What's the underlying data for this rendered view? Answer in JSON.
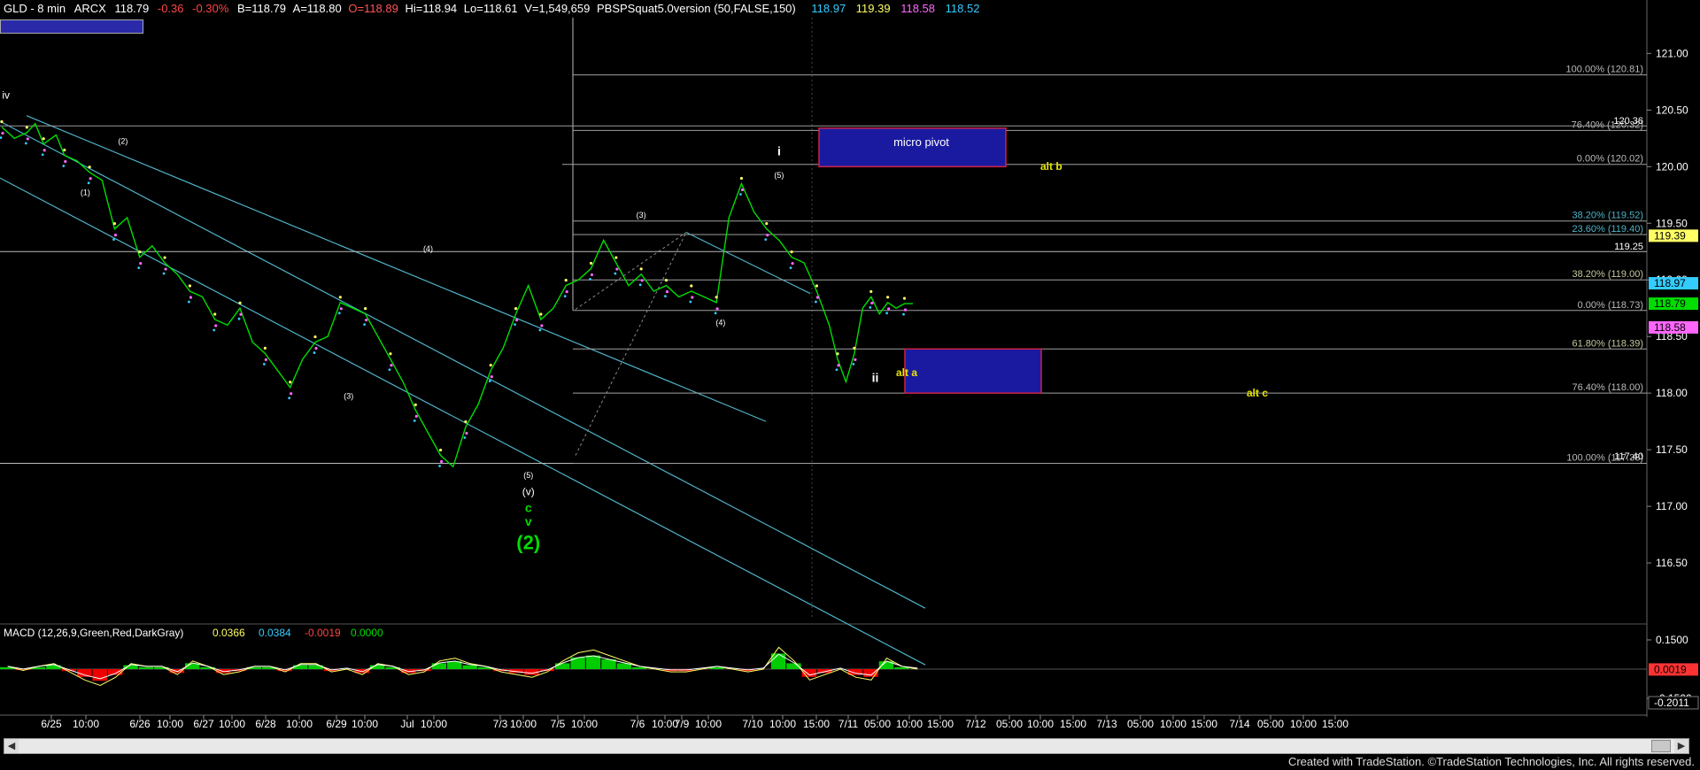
{
  "header": {
    "symbol": "GLD - 8 min",
    "exchange": "ARCX",
    "last": "118.79",
    "change": "-0.36",
    "change_pct": "-0.30%",
    "bid": "B=118.79",
    "ask": "A=118.80",
    "open": "O=118.89",
    "high": "Hi=118.94",
    "low": "Lo=118.61",
    "volume": "V=1,549,659",
    "indicator": "PBSPSquat5.0version (50,FALSE,150)",
    "ind_vals": [
      "118.97",
      "119.39",
      "118.58",
      "118.52"
    ]
  },
  "colors": {
    "background": "#000000",
    "price": "#00dd00",
    "dot_yellow": "#ffff66",
    "dot_pink": "#ff66ff",
    "dot_cyan": "#33ccff",
    "channel": "#4fb3c8",
    "fib": "#a0a0a0",
    "wave_label": "#ffffff",
    "wave_green": "#00dd00",
    "alt_label": "#e6e600",
    "box_fill": "#1a1aa0",
    "box_border": "#cc2244",
    "macd_up": "#00cc00",
    "macd_down": "#ee0000"
  },
  "chart_data": {
    "type": "line",
    "title": "GLD - 8 min",
    "x_tick_labels": [
      "6/25",
      "10:00",
      "6/26",
      "10:00",
      "6/27",
      "10:00",
      "6/28",
      "10:00",
      "6/29",
      "10:00",
      "Jul",
      "10:00",
      "7/3",
      "10:00",
      "7/5",
      "10:00",
      "7/6",
      "10:00",
      "7/9",
      "10:00",
      "7/10",
      "10:00",
      "15:00",
      "7/11",
      "05:00",
      "10:00",
      "15:00",
      "7/12",
      "05:00",
      "10:00",
      "15:00",
      "7/13",
      "05:00",
      "10:00",
      "15:00",
      "7/14",
      "05:00",
      "10:00",
      "15:00"
    ],
    "y_tick_labels": [
      "121.00",
      "120.50",
      "120.00",
      "119.50",
      "119.00",
      "118.50",
      "118.00",
      "117.50",
      "117.00",
      "116.50"
    ],
    "ylim": [
      116.0,
      121.3
    ],
    "price_path": {
      "x_index": [
        0,
        3,
        6,
        8,
        10,
        13,
        15,
        18,
        21,
        24,
        27,
        30,
        33,
        36,
        39,
        42,
        45,
        48,
        51,
        54,
        57,
        60,
        63,
        66,
        69,
        72,
        75,
        78,
        81,
        84,
        87,
        90,
        93,
        96,
        99,
        102,
        105,
        108,
        111,
        114,
        117,
        120,
        123,
        126,
        129,
        132,
        135,
        138,
        141,
        144,
        147,
        150,
        153,
        156,
        159,
        162,
        165,
        168,
        171,
        174,
        177,
        180,
        183,
        186,
        189,
        192,
        195,
        198,
        200,
        202,
        204,
        206,
        208,
        210,
        212,
        214,
        216,
        218
      ],
      "close": [
        120.35,
        120.25,
        120.3,
        120.38,
        120.2,
        120.28,
        120.1,
        120.05,
        119.95,
        119.88,
        119.45,
        119.55,
        119.2,
        119.3,
        119.15,
        119.05,
        118.9,
        118.85,
        118.65,
        118.6,
        118.75,
        118.45,
        118.35,
        118.2,
        118.05,
        118.3,
        118.45,
        118.5,
        118.8,
        118.75,
        118.7,
        118.5,
        118.3,
        118.1,
        117.85,
        117.65,
        117.45,
        117.35,
        117.7,
        117.9,
        118.2,
        118.4,
        118.7,
        118.95,
        118.65,
        118.75,
        118.95,
        119.0,
        119.1,
        119.35,
        119.15,
        118.95,
        119.05,
        118.9,
        118.95,
        118.85,
        118.9,
        118.85,
        118.8,
        119.55,
        119.85,
        119.6,
        119.45,
        119.35,
        119.2,
        119.15,
        118.9,
        118.6,
        118.3,
        118.1,
        118.35,
        118.75,
        118.85,
        118.7,
        118.8,
        118.75,
        118.79,
        118.79
      ]
    },
    "fib_levels": [
      {
        "label": "100.00% (120.81)",
        "value": 120.81
      },
      {
        "label": "76.40% (120.32)",
        "value": 120.32
      },
      {
        "label": "0.00% (120.02)",
        "value": 120.02
      },
      {
        "label": "38.20% (119.52)",
        "value": 119.52
      },
      {
        "label": "23.60% (119.40)",
        "value": 119.4
      },
      {
        "label": "38.20% (119.00)",
        "value": 119.0
      },
      {
        "label": "0.00% (118.73)",
        "value": 118.73
      },
      {
        "label": "61.80% (118.39)",
        "value": 118.39
      },
      {
        "label": "76.40% (118.00)",
        "value": 118.0
      },
      {
        "label": "100.00% (117.38)",
        "value": 117.38
      }
    ],
    "price_tags": [
      {
        "value": 119.39,
        "label": "119.39",
        "color": "#ffff66"
      },
      {
        "value": 118.97,
        "label": "118.97",
        "color": "#33ccff"
      },
      {
        "value": 118.79,
        "label": "118.79",
        "color": "#00dd00"
      },
      {
        "value": 118.58,
        "label": "118.58",
        "color": "#ff66ff"
      }
    ],
    "level_text": [
      {
        "value": 119.25,
        "label": "119.25"
      },
      {
        "value": 120.36,
        "label": "120.36"
      },
      {
        "value": 117.4,
        "label": "117.40"
      }
    ],
    "wave_labels": [
      {
        "text": "iv",
        "x_index": 1,
        "value": 120.6,
        "color": "#ffffff",
        "size": 12
      },
      {
        "text": "(1)",
        "x_index": 20,
        "value": 119.75,
        "color": "#ffffff",
        "size": 9
      },
      {
        "text": "(2)",
        "x_index": 29,
        "value": 120.2,
        "color": "#ffffff",
        "size": 9
      },
      {
        "text": "(3)",
        "x_index": 83,
        "value": 117.95,
        "color": "#ffffff",
        "size": 9
      },
      {
        "text": "(4)",
        "x_index": 102,
        "value": 119.25,
        "color": "#ffffff",
        "size": 9
      },
      {
        "text": "(5)",
        "x_index": 126,
        "value": 117.25,
        "color": "#ffffff",
        "size": 9
      },
      {
        "text": "(v)",
        "x_index": 126,
        "value": 117.1,
        "color": "#ffffff",
        "size": 12
      },
      {
        "text": "c",
        "x_index": 126,
        "value": 116.95,
        "color": "#00dd00",
        "size": 14
      },
      {
        "text": "v",
        "x_index": 126,
        "value": 116.83,
        "color": "#00dd00",
        "size": 14
      },
      {
        "text": "(2)",
        "x_index": 126,
        "value": 116.62,
        "color": "#00dd00",
        "size": 22
      },
      {
        "text": "(3)",
        "x_index": 153,
        "value": 119.55,
        "color": "#ffffff",
        "size": 9
      },
      {
        "text": "(4)",
        "x_index": 172,
        "value": 118.6,
        "color": "#ffffff",
        "size": 9
      },
      {
        "text": "(5)",
        "x_index": 186,
        "value": 119.9,
        "color": "#ffffff",
        "size": 9
      },
      {
        "text": "i",
        "x_index": 186,
        "value": 120.1,
        "color": "#ffffff",
        "size": 14
      },
      {
        "text": "ii",
        "x_index": 209,
        "value": 118.1,
        "color": "#ffffff",
        "size": 14
      }
    ],
    "alt_labels": [
      {
        "text": "alt b",
        "x": 1175,
        "y": 192
      },
      {
        "text": "alt a",
        "x": 1012,
        "y": 425
      },
      {
        "text": "alt c",
        "x": 1408,
        "y": 448
      }
    ],
    "boxes": [
      {
        "label": "micro pivot",
        "hi": 120.34,
        "lo": 120.0,
        "x1": 925,
        "x2": 1136
      },
      {
        "label": "",
        "hi": 118.39,
        "lo": 118.0,
        "x1": 1022,
        "x2": 1176
      }
    ],
    "macd": {
      "title": "MACD (12,26,9,Green,Red,DarkGray)",
      "values": [
        "0.0366",
        "0.0384",
        "-0.0019",
        "0.0000"
      ],
      "value_colors": [
        "#ffff66",
        "#33ccff",
        "#ff4444",
        "#00dd00"
      ],
      "y_tick_labels": [
        "0.1500",
        "-0.1500"
      ],
      "ylim": [
        -0.2,
        0.2
      ],
      "tags": [
        {
          "label": "0.0019",
          "value": -0.0019
        },
        {
          "label": "-0.2011",
          "value": -0.2011
        }
      ],
      "hist": [
        0.01,
        -0.005,
        0.01,
        0.02,
        -0.01,
        -0.04,
        -0.06,
        -0.03,
        0.02,
        0.01,
        0.01,
        -0.02,
        0.03,
        0.01,
        -0.02,
        -0.01,
        0.01,
        0.01,
        -0.01,
        0.02,
        0.02,
        -0.01,
        0.0,
        -0.02,
        0.02,
        0.01,
        -0.02,
        -0.01,
        0.03,
        0.04,
        0.02,
        0.01,
        -0.01,
        -0.02,
        -0.03,
        -0.01,
        0.03,
        0.06,
        0.07,
        0.05,
        0.03,
        0.01,
        0.0,
        -0.01,
        -0.01,
        0.0,
        0.01,
        0.0,
        -0.01,
        0.0,
        0.08,
        0.03,
        -0.04,
        -0.02,
        0.0,
        -0.03,
        -0.04,
        0.04,
        0.01,
        0.0
      ]
    }
  },
  "footer": {
    "credit": "Created with TradeStation. ©TradeStation Technologies, Inc. All rights reserved."
  }
}
